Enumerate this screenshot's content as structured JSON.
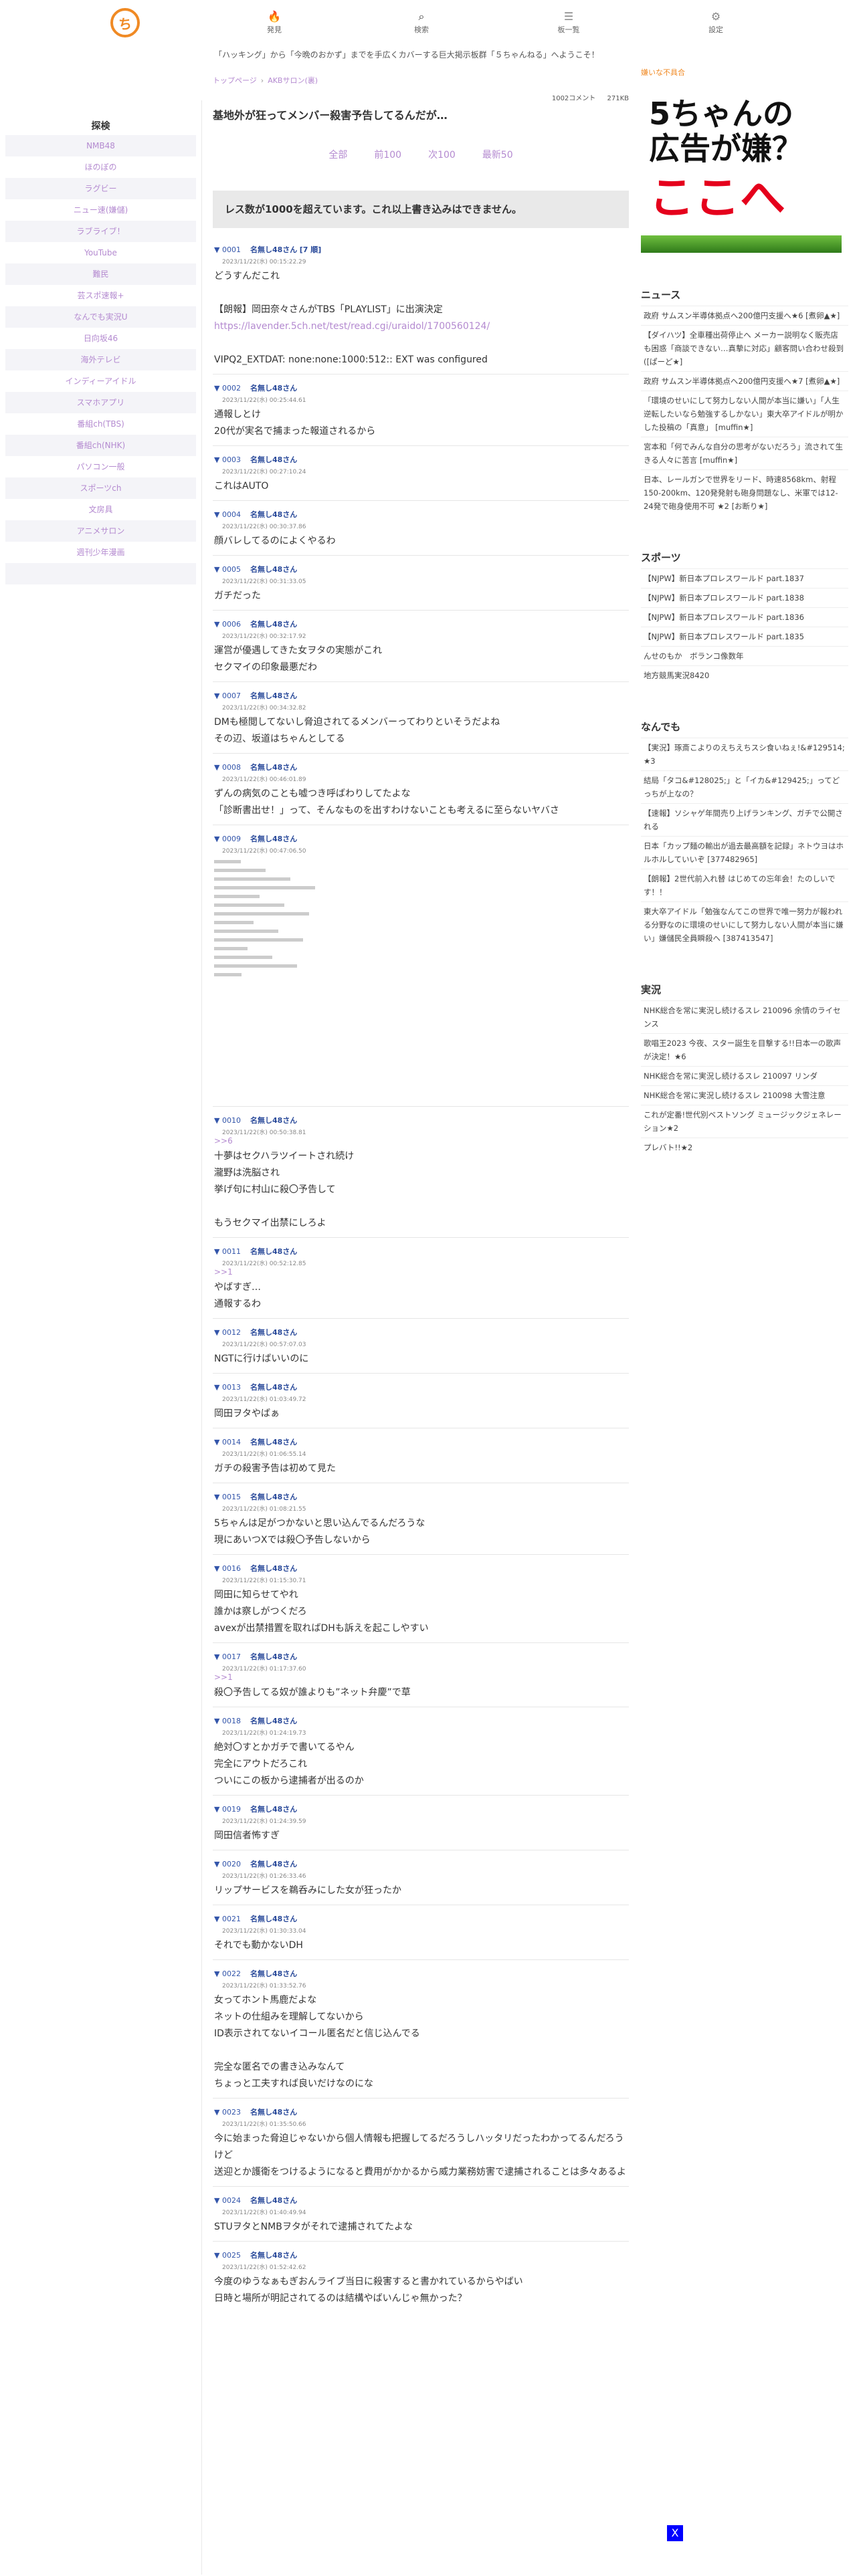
{
  "header": {
    "logo_text": "ち",
    "nav": [
      {
        "label": "発見",
        "icon": "fire-icon"
      },
      {
        "label": "検索",
        "icon": "search-icon"
      },
      {
        "label": "板一覧",
        "icon": "list-icon"
      },
      {
        "label": "設定",
        "icon": "gear-icon"
      }
    ],
    "marquee": "「ハッキング」から「今晩のおかず」までを手広くカバーする巨大掲示板群「５ちゃんねる」へようこそ！"
  },
  "left_sidebar": {
    "title": "探検",
    "items": [
      "NMB48",
      "ほのぼの",
      "ラグビー",
      "ニュー速(嫌儲)",
      "ラブライブ！",
      "YouTube",
      "難民",
      "芸スポ速報+",
      "なんでも実況U",
      "日向坂46",
      "海外テレビ",
      "インディーアイドル",
      "スマホアプリ",
      "番組ch(TBS)",
      "番組ch(NHK)",
      "パソコン一般",
      "スポーツch",
      "文房具",
      "アニメサロン",
      "週刊少年漫画"
    ]
  },
  "thread": {
    "breadcrumb": [
      "トップページ",
      "AKBサロン(裏)"
    ],
    "breadcrumb_sep": "›",
    "comments": "1002コメント",
    "size": "271KB",
    "title": "基地外が狂ってメンバー殺害予告してるんだが…",
    "pager": [
      "全部",
      "前100",
      "次100",
      "最新50"
    ],
    "over_notice": "レス数が1000を超えています。これ以上書き込みはできません。"
  },
  "posts": [
    {
      "num": "0001",
      "name": "名無し48さん",
      "extra": "[7 順]",
      "date": "2023/11/22(水) 00:15:22.29",
      "body": [
        "どうすんだこれ",
        "",
        "【朗報】岡田奈々さんがTBS「PLAYLIST」に出演決定"
      ],
      "link": "https://lavender.5ch.net/test/read.cgi/uraidol/1700560124/",
      "body2": [
        "",
        "VIPQ2_EXTDAT: none:none:1000:512:: EXT was configured"
      ]
    },
    {
      "num": "0002",
      "name": "名無し48さん",
      "date": "2023/11/22(水) 00:25:44.61",
      "body": [
        "通報しとけ",
        "20代が実名で捕まった報道されるから"
      ]
    },
    {
      "num": "0003",
      "name": "名無し48さん",
      "date": "2023/11/22(水) 00:27:10.24",
      "body": [
        "これはAUTO"
      ]
    },
    {
      "num": "0004",
      "name": "名無し48さん",
      "date": "2023/11/22(水) 00:30:37.86",
      "body": [
        "顔バレしてるのによくやるわ"
      ]
    },
    {
      "num": "0005",
      "name": "名無し48さん",
      "date": "2023/11/22(水) 00:31:33.05",
      "body": [
        "ガチだった"
      ]
    },
    {
      "num": "0006",
      "name": "名無し48さん",
      "date": "2023/11/22(水) 00:32:17.92",
      "body": [
        "運営が優遇してきた女ヲタの実態がこれ",
        "セクマイの印象最悪だわ"
      ]
    },
    {
      "num": "0007",
      "name": "名無し48さん",
      "date": "2023/11/22(水) 00:34:32.82",
      "body": [
        "DMも極閲してないし脅迫されてるメンバーってわりといそうだよね",
        "その辺、坂道はちゃんとしてる"
      ]
    },
    {
      "num": "0008",
      "name": "名無し48さん",
      "date": "2023/11/22(水) 00:46:01.89",
      "body": [
        "ずんの病気のことも嘘つき呼ばわりしてたよな",
        "「診断書出せ！」って、そんなものを出すわけないことも考えるに至らないヤバさ"
      ]
    },
    {
      "num": "0009",
      "name": "名無し48さん",
      "date": "2023/11/22(水) 00:47:06.50",
      "aa": true,
      "body": []
    },
    {
      "num": "0010",
      "name": "名無し48さん",
      "date": "2023/11/22(水) 00:50:38.81",
      "anchor": ">>6",
      "body": [
        "十夢はセクハラツイートされ続け",
        "瀧野は洗脳され",
        "挙げ句に村山に殺〇予告して",
        "",
        "もうセクマイ出禁にしろよ"
      ]
    },
    {
      "num": "0011",
      "name": "名無し48さん",
      "date": "2023/11/22(水) 00:52:12.85",
      "anchor": ">>1",
      "body": [
        "やばすぎ…",
        "通報するわ"
      ]
    },
    {
      "num": "0012",
      "name": "名無し48さん",
      "date": "2023/11/22(水) 00:57:07.03",
      "body": [
        "NGTに行けばいいのに"
      ]
    },
    {
      "num": "0013",
      "name": "名無し48さん",
      "date": "2023/11/22(水) 01:03:49.72",
      "body": [
        "岡田ヲタやばぁ"
      ]
    },
    {
      "num": "0014",
      "name": "名無し48さん",
      "date": "2023/11/22(水) 01:06:55.14",
      "body": [
        "ガチの殺害予告は初めて見た"
      ]
    },
    {
      "num": "0015",
      "name": "名無し48さん",
      "date": "2023/11/22(水) 01:08:21.55",
      "body": [
        "5ちゃんは足がつかないと思い込んでるんだろうな",
        "現にあいつXでは殺〇予告しないから"
      ]
    },
    {
      "num": "0016",
      "name": "名無し48さん",
      "date": "2023/11/22(水) 01:15:30.71",
      "body": [
        "岡田に知らせてやれ",
        "誰かは察しがつくだろ",
        "avexが出禁措置を取ればDHも訴えを起こしやすい"
      ]
    },
    {
      "num": "0017",
      "name": "名無し48さん",
      "date": "2023/11/22(水) 01:17:37.60",
      "anchor": ">>1",
      "body": [
        "殺〇予告してる奴が誰よりも”ネット弁慶”で草"
      ]
    },
    {
      "num": "0018",
      "name": "名無し48さん",
      "date": "2023/11/22(水) 01:24:19.73",
      "body": [
        "絶対〇すとかガチで書いてるやん",
        "完全にアウトだろこれ",
        "ついにこの板から逮捕者が出るのか"
      ]
    },
    {
      "num": "0019",
      "name": "名無し48さん",
      "date": "2023/11/22(水) 01:24:39.59",
      "body": [
        "岡田信者怖すぎ"
      ]
    },
    {
      "num": "0020",
      "name": "名無し48さん",
      "date": "2023/11/22(水) 01:26:33.46",
      "body": [
        "リップサービスを鵜呑みにした女が狂ったか"
      ]
    },
    {
      "num": "0021",
      "name": "名無し48さん",
      "date": "2023/11/22(水) 01:30:33.04",
      "body": [
        "それでも動かないDH"
      ]
    },
    {
      "num": "0022",
      "name": "名無し48さん",
      "date": "2023/11/22(水) 01:33:52.76",
      "body": [
        "女ってホント馬鹿だよな",
        "ネットの仕組みを理解してないから",
        "ID表示されてないイコール匿名だと信じ込んでる",
        "",
        "完全な匿名での書き込みなんて",
        "ちょっと工夫すれば良いだけなのにな"
      ]
    },
    {
      "num": "0023",
      "name": "名無し48さん",
      "date": "2023/11/22(水) 01:35:50.66",
      "body": [
        "今に始まった脅迫じゃないから個人情報も把握してるだろうしハッタリだったわかってるんだろうけど",
        "送迎とか護衛をつけるようになると費用がかかるから威力業務妨害で逮捕されることは多々あるよ"
      ]
    },
    {
      "num": "0024",
      "name": "名無し48さん",
      "date": "2023/11/22(水) 01:40:49.94",
      "body": [
        "STUヲタとNMBヲタがそれで逮捕されてたよな"
      ]
    },
    {
      "num": "0025",
      "name": "名無し48さん",
      "date": "2023/11/22(水) 01:52:42.62",
      "body": [
        "今度のゆうなぁもぎおんライブ当日に殺害すると書かれているからやばい",
        "日時と場所が明記されてるのは結構やばいんじゃ無かった？"
      ]
    }
  ],
  "right_sidebar": {
    "ad_label": "嫌いな不具合",
    "ad_lines": [
      "5ちゃんの",
      "広告が嫌？",
      "ここへ"
    ],
    "sections": [
      {
        "title": "ニュース",
        "items": [
          "政府 サムスン半導体拠点へ200億円支援へ★6 [煮卵▲★]",
          "【ダイハツ】全車種出荷停止へ メーカー説明なく販売店も困惑「商談できない…真摯に対応」顧客問い合わせ殺到 ([ぱーど★]",
          "政府 サムスン半導体拠点へ200億円支援へ★7 [煮卵▲★]",
          "「環境のせいにして努力しない人間が本当に嫌い」「人生逆転したいなら勉強するしかない」東大卒アイドルが明かした投稿の「真意」 [muffin★]",
          "宮本和「何でみんな自分の思考がないだろう」流されて生きる人々に苦言 [muffin★]",
          "日本、レールガンで世界をリード、時速8568km、射程150-200km、120発発射も砲身問題なし、米軍では12-24発で砲身使用不可 ★2 [お断り★]"
        ]
      },
      {
        "title": "スポーツ",
        "items": [
          "【NJPW】新日本プロレスワールド part.1837",
          "【NJPW】新日本プロレスワールド part.1838",
          "【NJPW】新日本プロレスワールド part.1836",
          "【NJPW】新日本プロレスワールド part.1835",
          "んせのもか　ボランコ像数年",
          "地方競馬実況8420"
        ]
      },
      {
        "title": "なんでも",
        "items": [
          "【実況】琢斎こよりのえちえちスシ食いねぇ!&#129514; ★3",
          "結局「タコ&#128025;」と「イカ&#129425;」ってどっちが上なの？",
          "【速報】ソシャゲ年間売り上げランキング、ガチで公開される",
          "日本「カップ麺の輸出が過去最高額を記録」ネトウヨはホルホルしていいぞ [377482965]",
          "【朗報】2世代前入れ替 はじめての忘年会！たのしいです！！",
          "東大卒アイドル「勉強なんてこの世界で唯一努力が報われる分野なのに環境のせいにして努力しない人間が本当に嫌い」嫌儲民全員瞬殺へ [387413547]"
        ]
      },
      {
        "title": "実況",
        "items": [
          "NHK総合を常に実況し続けるスレ 210096 余情のライセンス",
          "歌唱王2023 今夜、スター誕生を目撃する!!日本一の歌声が決定！★6",
          "NHK総合を常に実況し続けるスレ 210097 リンダ",
          "NHK総合を常に実況し続けるスレ 210098 大雪注意",
          "これが定番!世代別ベストソング ミュージックジェネレーション★2",
          "プレバト!!★2"
        ]
      }
    ]
  },
  "close_button": "X"
}
